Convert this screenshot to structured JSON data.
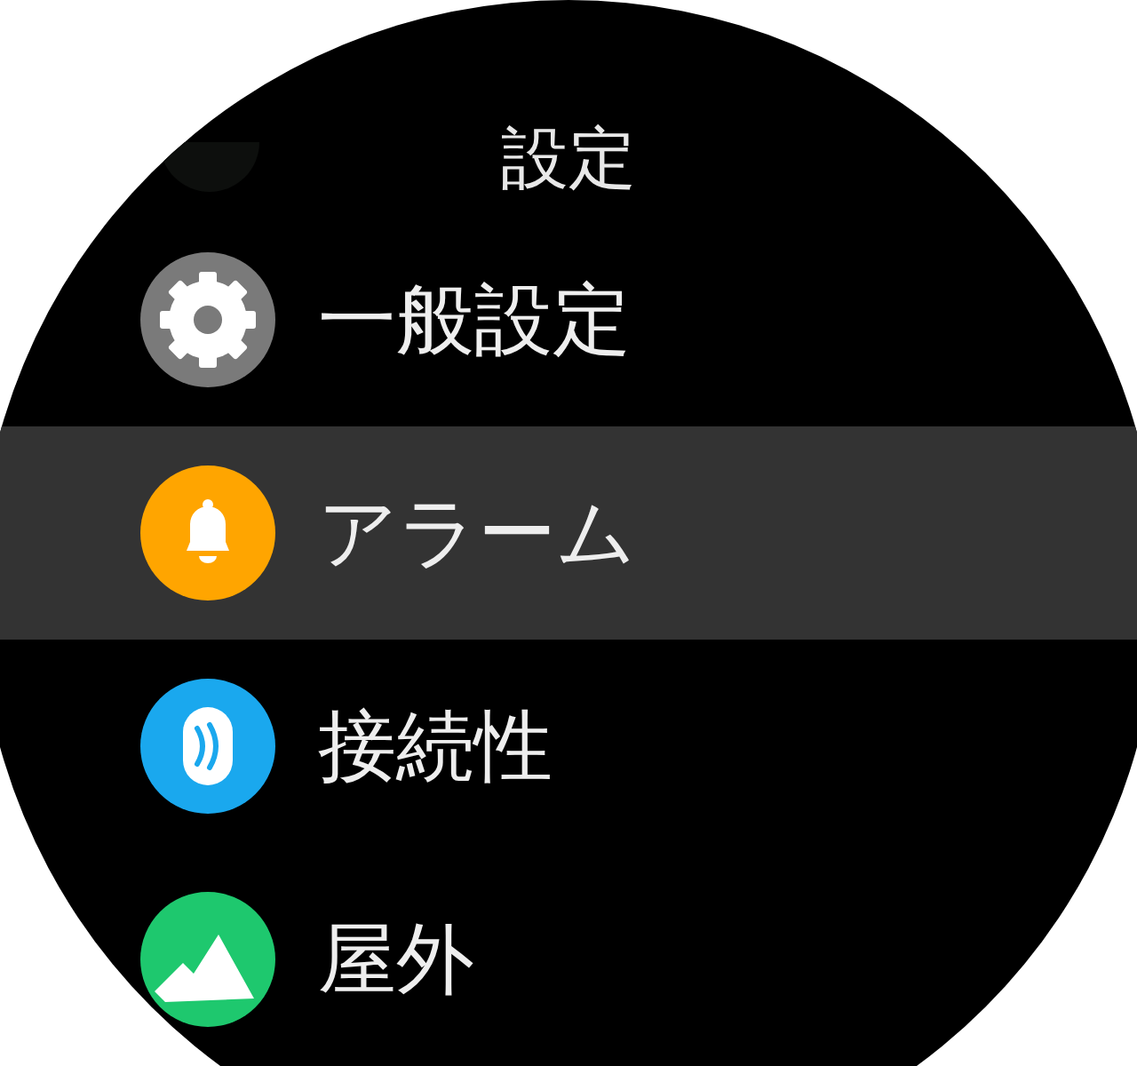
{
  "title": "設定",
  "menu": [
    {
      "label": "一般設定",
      "color": "#7a7a7a",
      "selected": false
    },
    {
      "label": "アラーム",
      "color": "#ffa500",
      "selected": true
    },
    {
      "label": "接続性",
      "color": "#1aa8ee",
      "selected": false
    },
    {
      "label": "屋外",
      "color": "#1ec86e",
      "selected": false
    }
  ]
}
